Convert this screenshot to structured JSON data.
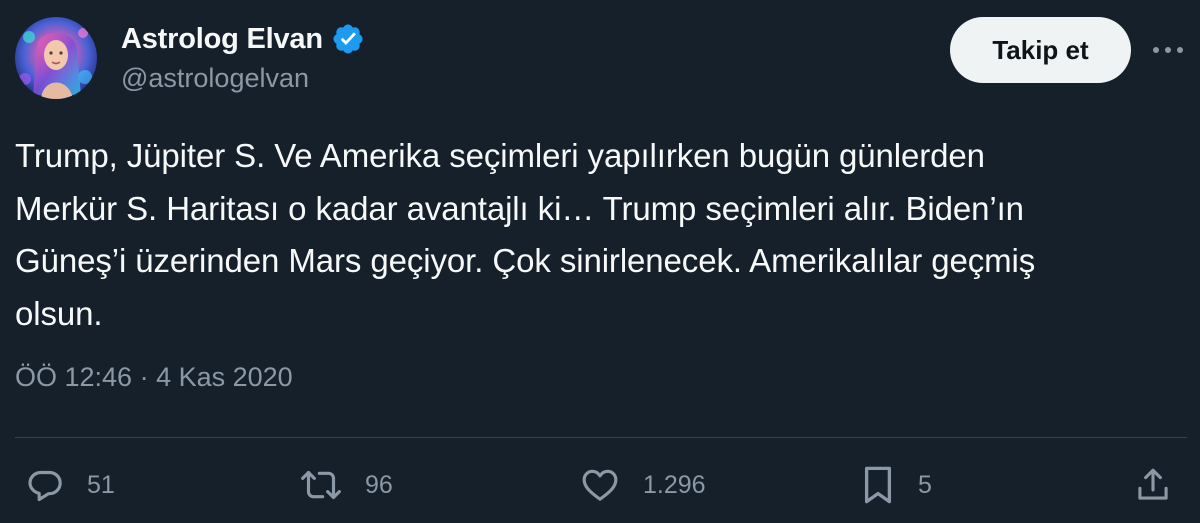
{
  "author": {
    "display_name": "Astrolog Elvan",
    "handle": "@astrologelvan",
    "verified": true,
    "avatar_icon": "profile-photo"
  },
  "header": {
    "follow_label": "Takip et",
    "more_icon": "more-horizontal-icon"
  },
  "tweet": {
    "text": "Trump, Jüpiter S. Ve Amerika seçimleri yapılırken bugün günlerden\nMerkür S. Haritası o kadar avantajlı ki… Trump seçimleri alır. Biden’ın\nGüneş’i üzerinden Mars geçiyor. Çok sinirlenecek. Amerikalılar geçmiş\nolsun.",
    "timestamp": "ÖÖ 12:46 · 4 Kas 2020"
  },
  "actions": {
    "reply_count": "51",
    "retweet_count": "96",
    "like_count": "1.296",
    "bookmark_count": "5"
  },
  "colors": {
    "background": "#15202b",
    "primary_text": "#f7f9f9",
    "secondary_text": "#8b98a5",
    "verified_badge": "#1d9bf0",
    "follow_button_bg": "#eff3f4",
    "divider": "#38444d"
  }
}
